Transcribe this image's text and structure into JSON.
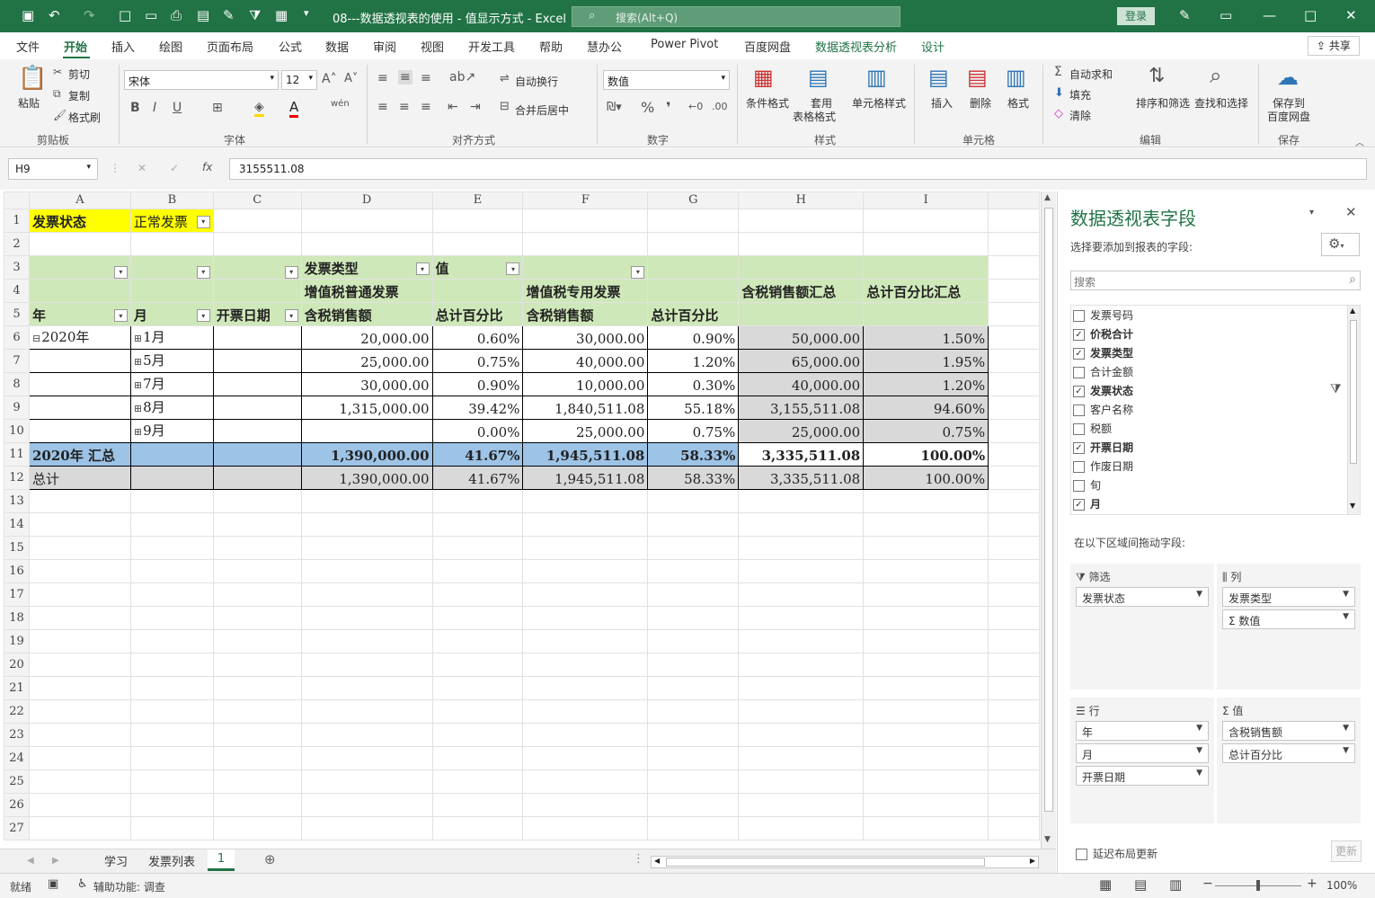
{
  "titlebar": {
    "doc_title": "08---数据透视表的使用 - 值显示方式 - Excel",
    "search_placeholder": "搜索(Alt+Q)",
    "login": "登录"
  },
  "menu": {
    "items": [
      "文件",
      "开始",
      "插入",
      "绘图",
      "页面布局",
      "公式",
      "数据",
      "审阅",
      "视图",
      "开发工具",
      "帮助",
      "慧办公",
      "Power Pivot",
      "百度网盘",
      "数据透视表分析",
      "设计"
    ],
    "share": "共享"
  },
  "ribbon": {
    "clipboard": {
      "paste": "粘贴",
      "cut": "剪切",
      "copy": "复制",
      "format_painter": "格式刷",
      "group": "剪贴板"
    },
    "font": {
      "name": "宋体",
      "size": "12",
      "group": "字体"
    },
    "alignment": {
      "wrap": "自动换行",
      "merge": "合并后居中",
      "group": "对齐方式"
    },
    "number": {
      "format": "数值",
      "group": "数字"
    },
    "styles": {
      "conditional": "条件格式",
      "table_format_1": "套用",
      "table_format_2": "表格格式",
      "cell_styles": "单元格样式",
      "group": "样式"
    },
    "cells": {
      "insert": "插入",
      "delete": "删除",
      "format": "格式",
      "group": "单元格"
    },
    "editing": {
      "autosum": "自动求和",
      "fill": "填充",
      "clear": "清除",
      "sort_filter": "排序和筛选",
      "find_select": "查找和选择",
      "group": "编辑"
    },
    "save": {
      "label_1": "保存到",
      "label_2": "百度网盘",
      "group": "保存"
    }
  },
  "formula_bar": {
    "name_box": "H9",
    "formula": "3155511.08"
  },
  "grid": {
    "columns": [
      "A",
      "B",
      "C",
      "D",
      "E",
      "F",
      "G",
      "H",
      "I"
    ],
    "rows": {
      "r1": {
        "a": "发票状态",
        "b": "正常发票"
      },
      "r3": {
        "d": "发票类型",
        "e": "值"
      },
      "r4": {
        "d": "增值税普通发票",
        "f": "增值税专用发票",
        "h": "含税销售额汇总",
        "i": "总计百分比汇总"
      },
      "r5": {
        "a": "年",
        "b": "月",
        "c": "开票日期",
        "d": "含税销售额",
        "e": "总计百分比",
        "f": "含税销售额",
        "g": "总计百分比"
      },
      "r6": {
        "a": "2020年",
        "b": "1月",
        "d": "20,000.00",
        "e": "0.60%",
        "f": "30,000.00",
        "g": "0.90%",
        "h": "50,000.00",
        "i": "1.50%"
      },
      "r7": {
        "b": "5月",
        "d": "25,000.00",
        "e": "0.75%",
        "f": "40,000.00",
        "g": "1.20%",
        "h": "65,000.00",
        "i": "1.95%"
      },
      "r8": {
        "b": "7月",
        "d": "30,000.00",
        "e": "0.90%",
        "f": "10,000.00",
        "g": "0.30%",
        "h": "40,000.00",
        "i": "1.20%"
      },
      "r9": {
        "b": "8月",
        "d": "1,315,000.00",
        "e": "39.42%",
        "f": "1,840,511.08",
        "g": "55.18%",
        "h": "3,155,511.08",
        "i": "94.60%"
      },
      "r10": {
        "b": "9月",
        "d": "",
        "e": "0.00%",
        "f": "25,000.00",
        "g": "0.75%",
        "h": "25,000.00",
        "i": "0.75%"
      },
      "r11": {
        "a": "2020年 汇总",
        "d": "1,390,000.00",
        "e": "41.67%",
        "f": "1,945,511.08",
        "g": "58.33%",
        "h": "3,335,511.08",
        "i": "100.00%"
      },
      "r12": {
        "a": "总计",
        "d": "1,390,000.00",
        "e": "41.67%",
        "f": "1,945,511.08",
        "g": "58.33%",
        "h": "3,335,511.08",
        "i": "100.00%"
      }
    }
  },
  "sheet_tabs": {
    "tab1": "学习",
    "tab2": "发票列表",
    "tab3": "1"
  },
  "status": {
    "ready": "就绪",
    "accessibility": "辅助功能: 调查",
    "zoom": "100%"
  },
  "pivot_pane": {
    "title": "数据透视表字段",
    "subtitle": "选择要添加到报表的字段:",
    "search_placeholder": "搜索",
    "fields": [
      {
        "label": "发票号码",
        "checked": false
      },
      {
        "label": "价税合计",
        "checked": true
      },
      {
        "label": "发票类型",
        "checked": true
      },
      {
        "label": "合计金额",
        "checked": false
      },
      {
        "label": "发票状态",
        "checked": true
      },
      {
        "label": "客户名称",
        "checked": false
      },
      {
        "label": "税额",
        "checked": false
      },
      {
        "label": "开票日期",
        "checked": true
      },
      {
        "label": "作废日期",
        "checked": false
      },
      {
        "label": "旬",
        "checked": false
      },
      {
        "label": "月",
        "checked": true
      }
    ],
    "drag_label": "在以下区域间拖动字段:",
    "areas": {
      "filter": {
        "title": "筛选",
        "items": [
          "发票状态"
        ]
      },
      "columns": {
        "title": "列",
        "items": [
          "发票类型",
          "Σ 数值"
        ]
      },
      "rows": {
        "title": "行",
        "items": [
          "年",
          "月",
          "开票日期"
        ]
      },
      "values": {
        "title": "值",
        "items": [
          "含税销售额",
          "总计百分比"
        ]
      }
    },
    "defer_update": "延迟布局更新",
    "update_button": "更新"
  }
}
